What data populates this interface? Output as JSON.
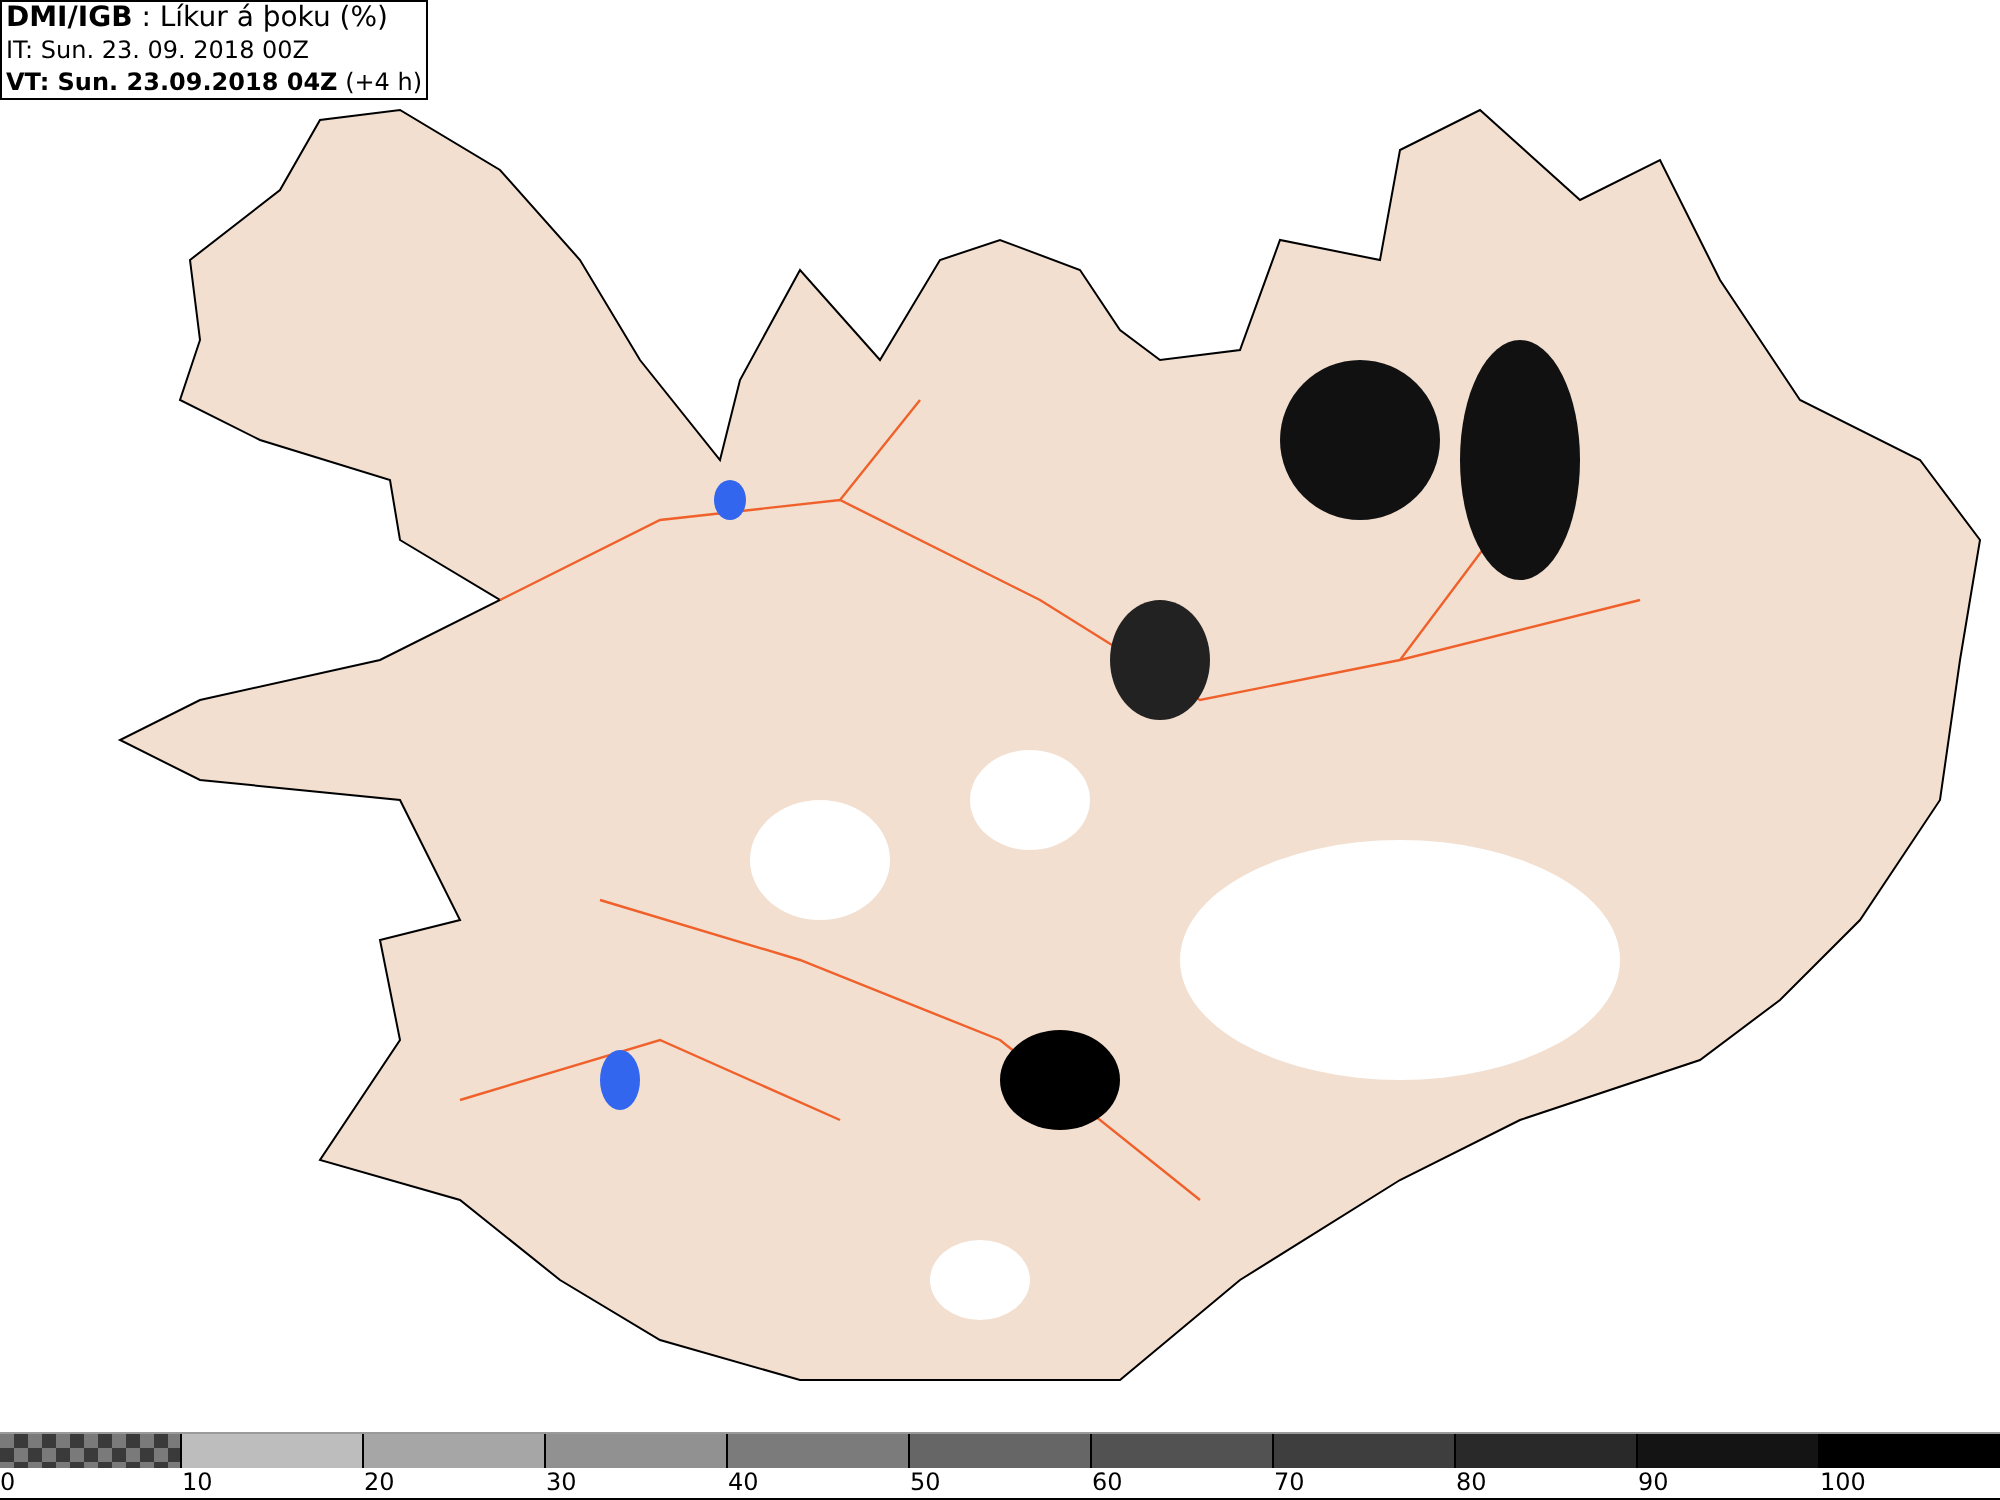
{
  "header": {
    "lines": [
      "**DMI/IGB** : Líkur á þoku (%)",
      "IT: Sun. 23. 09. 2018 00Z",
      "**VT: Sun. 23.09.2018 04Z** (+4 h)"
    ]
  },
  "legend": {
    "bins": [
      {
        "kind": "checker",
        "color": "#3a3a3a"
      },
      {
        "kind": "solid",
        "color": "#bdbdbd"
      },
      {
        "kind": "solid",
        "color": "#a6a6a6"
      },
      {
        "kind": "solid",
        "color": "#919191"
      },
      {
        "kind": "solid",
        "color": "#7b7b7b"
      },
      {
        "kind": "solid",
        "color": "#666666"
      },
      {
        "kind": "solid",
        "color": "#525252"
      },
      {
        "kind": "solid",
        "color": "#3e3e3e"
      },
      {
        "kind": "solid",
        "color": "#292929"
      },
      {
        "kind": "solid",
        "color": "#141414"
      },
      {
        "kind": "solid",
        "color": "#000000"
      }
    ],
    "labels": [
      "0",
      "10",
      "20",
      "30",
      "40",
      "50",
      "60",
      "70",
      "80",
      "90",
      "100"
    ]
  }
}
